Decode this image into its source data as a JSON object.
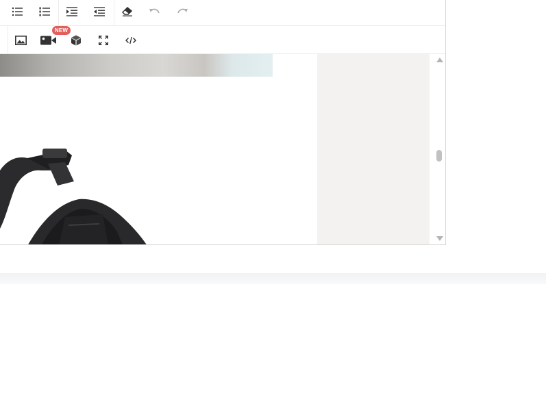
{
  "toolbar": {
    "row1": [
      {
        "name": "bulleted-list-icon"
      },
      {
        "name": "numbered-list-icon"
      },
      {
        "name": "indent-icon"
      },
      {
        "name": "outdent-icon"
      },
      {
        "name": "eraser-icon"
      },
      {
        "name": "undo-icon"
      },
      {
        "name": "redo-icon"
      }
    ],
    "row2": [
      {
        "name": "image-icon"
      },
      {
        "name": "video-icon"
      },
      {
        "name": "cube-icon"
      },
      {
        "name": "fullscreen-icon"
      },
      {
        "name": "code-view-icon"
      }
    ],
    "new_badge": "NEW"
  },
  "colors": {
    "badge": "#e35f5c",
    "side_panel": "#f3f2f0",
    "icon": "#333333",
    "icon_disabled": "#b0b0b0"
  }
}
